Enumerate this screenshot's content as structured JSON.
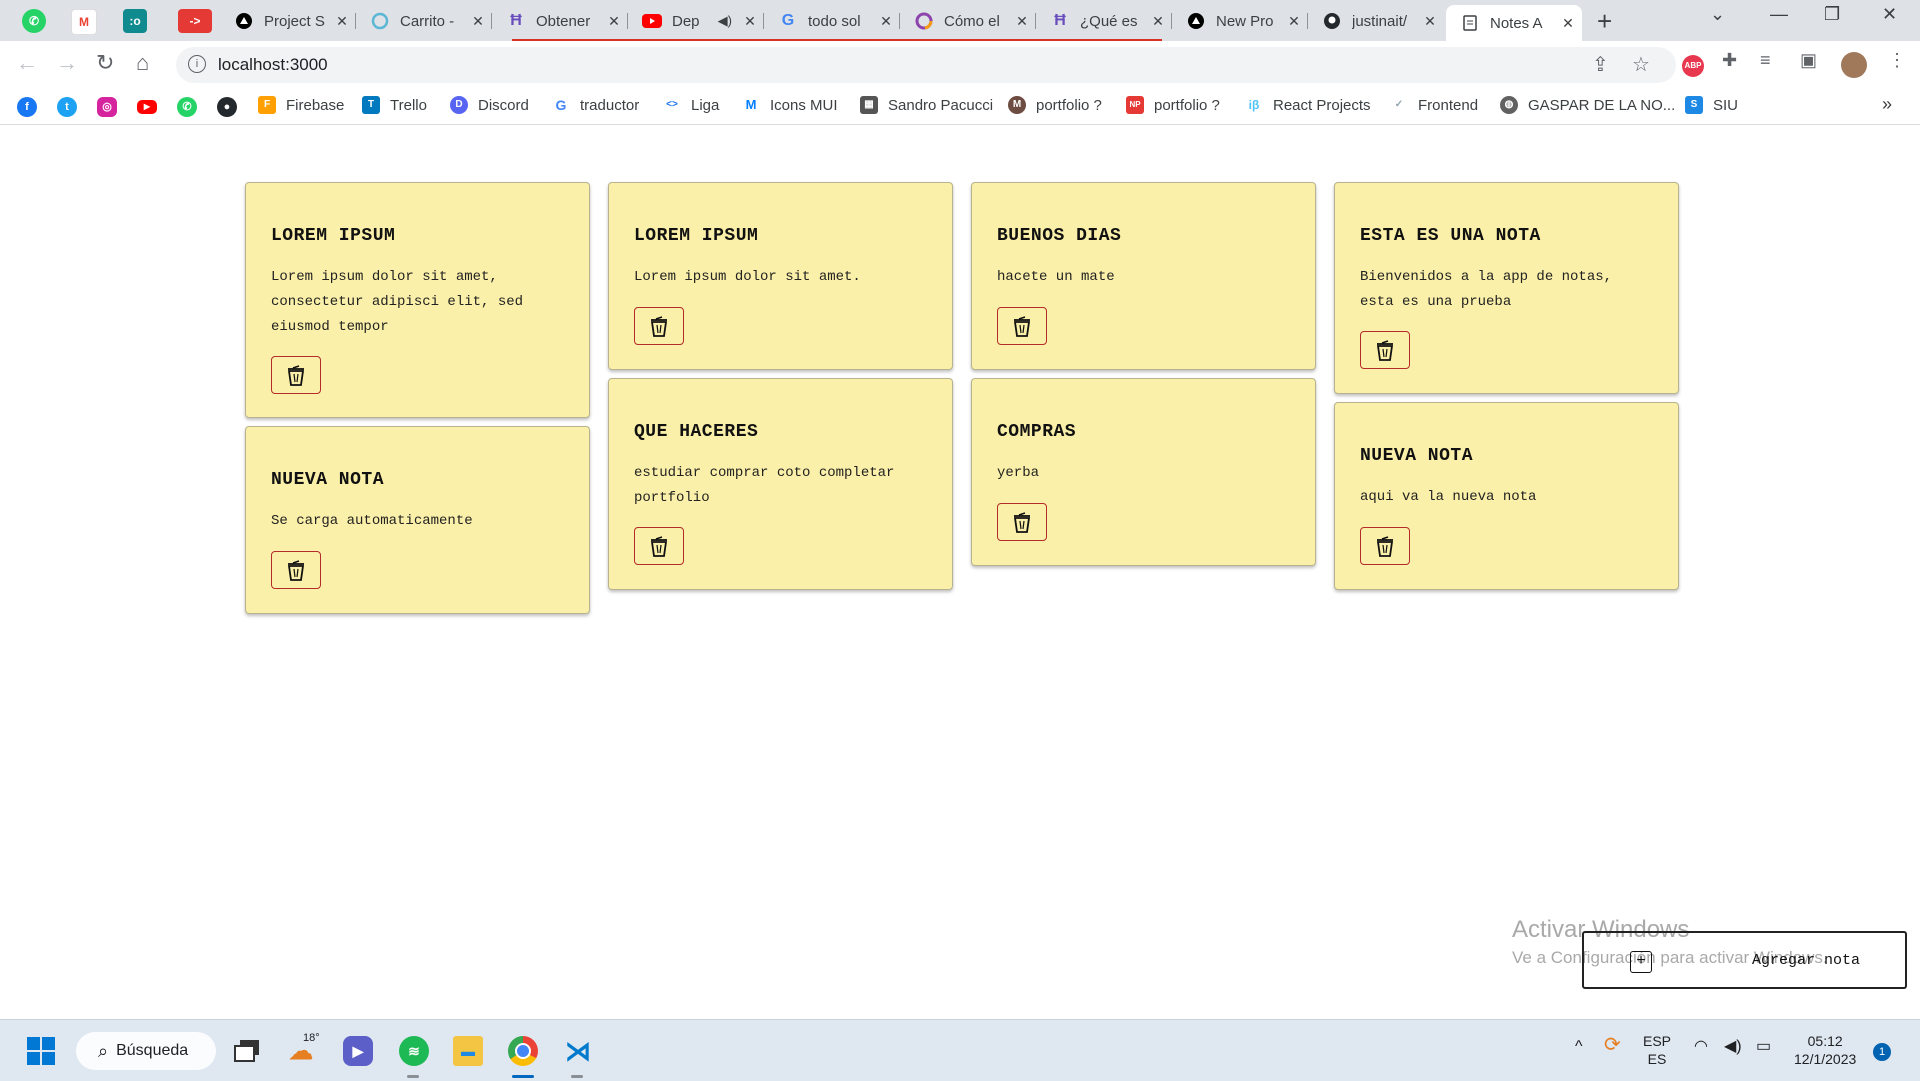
{
  "browser": {
    "tabs": [
      {
        "title": "Project S",
        "fav": "triangle",
        "color": "#000000"
      },
      {
        "title": "Carrito -",
        "fav": "swirl",
        "color": "#5bb7d6"
      },
      {
        "title": "Obtener",
        "fav": "H",
        "color": "#6a4dbd"
      },
      {
        "title": "Dep",
        "fav": "yt",
        "color": "#ff0000"
      },
      {
        "title": "todo sol",
        "fav": "G",
        "color": "#4285f4"
      },
      {
        "title": "Cómo el",
        "fav": "ring",
        "color": "#8e44ad"
      },
      {
        "title": "¿Qué es",
        "fav": "H",
        "color": "#6a4dbd"
      },
      {
        "title": "New Pro",
        "fav": "triangle",
        "color": "#000000"
      },
      {
        "title": "justinait/",
        "fav": "gh",
        "color": "#000000"
      },
      {
        "title": "Notes A",
        "fav": "note",
        "color": "#3c4043"
      }
    ],
    "pinned": [
      {
        "name": "whatsapp",
        "color": "#25d366",
        "glyph": "✆"
      },
      {
        "name": "gmail",
        "color": "#ea4335",
        "glyph": "M"
      },
      {
        "name": "app",
        "color": "#0f8a8f",
        "glyph": ":o"
      },
      {
        "name": "redirect",
        "color": "#e53935",
        "glyph": "->"
      }
    ],
    "url": "localhost:3000",
    "bookmarks": [
      {
        "label": "Firebase",
        "color": "#ffa000",
        "glyph": "F"
      },
      {
        "label": "Trello",
        "color": "#0079bf",
        "glyph": "T"
      },
      {
        "label": "Discord",
        "color": "#5865f2",
        "glyph": "D"
      },
      {
        "label": "traductor",
        "color": "#4285f4",
        "glyph": "G"
      },
      {
        "label": "Liga",
        "color": "#1a73e8",
        "glyph": "<>"
      },
      {
        "label": "Icons MUI",
        "color": "#007fff",
        "glyph": "M"
      },
      {
        "label": "Sandro Pacucci",
        "color": "#555555",
        "glyph": "S"
      },
      {
        "label": "portfolio ?",
        "color": "#6d4c41",
        "glyph": "M"
      },
      {
        "label": "portfolio ?",
        "color": "#e53935",
        "glyph": "NP"
      },
      {
        "label": "React Projects",
        "color": "#4fc3f7",
        "glyph": "iβ"
      },
      {
        "label": "Frontend",
        "color": "#90a4ae",
        "glyph": "✓"
      },
      {
        "label": "GASPAR DE LA NO...",
        "color": "#616161",
        "glyph": "G"
      },
      {
        "label": "SIU",
        "color": "#1e88e5",
        "glyph": "S"
      }
    ]
  },
  "notes": [
    {
      "title": "LOREM IPSUM",
      "body": "Lorem ipsum dolor sit amet, consectetur adipisci elit, sed eiusmod tempor"
    },
    {
      "title": "LOREM IPSUM",
      "body": "Lorem ipsum dolor sit amet."
    },
    {
      "title": "BUENOS DIAS",
      "body": "hacete un mate"
    },
    {
      "title": "ESTA ES UNA NOTA",
      "body": "Bienvenidos a la app de notas, esta es una prueba"
    },
    {
      "title": "NUEVA NOTA",
      "body": "Se carga automaticamente"
    },
    {
      "title": "QUE HACERES",
      "body": "estudiar comprar coto completar portfolio"
    },
    {
      "title": "COMPRAS",
      "body": "yerba"
    },
    {
      "title": "NUEVA NOTA",
      "body": "aqui va la nueva nota"
    }
  ],
  "add_note": {
    "label": "Agregar nota"
  },
  "watermark": {
    "line1": "Activar Windows",
    "line2": "Ve a Configuración para activar Windows."
  },
  "taskbar": {
    "search_label": "Búsqueda",
    "weather": "18°",
    "lang_top": "ESP",
    "lang_bottom": "ES",
    "time": "05:12",
    "date": "12/1/2023",
    "notifications": "1"
  }
}
